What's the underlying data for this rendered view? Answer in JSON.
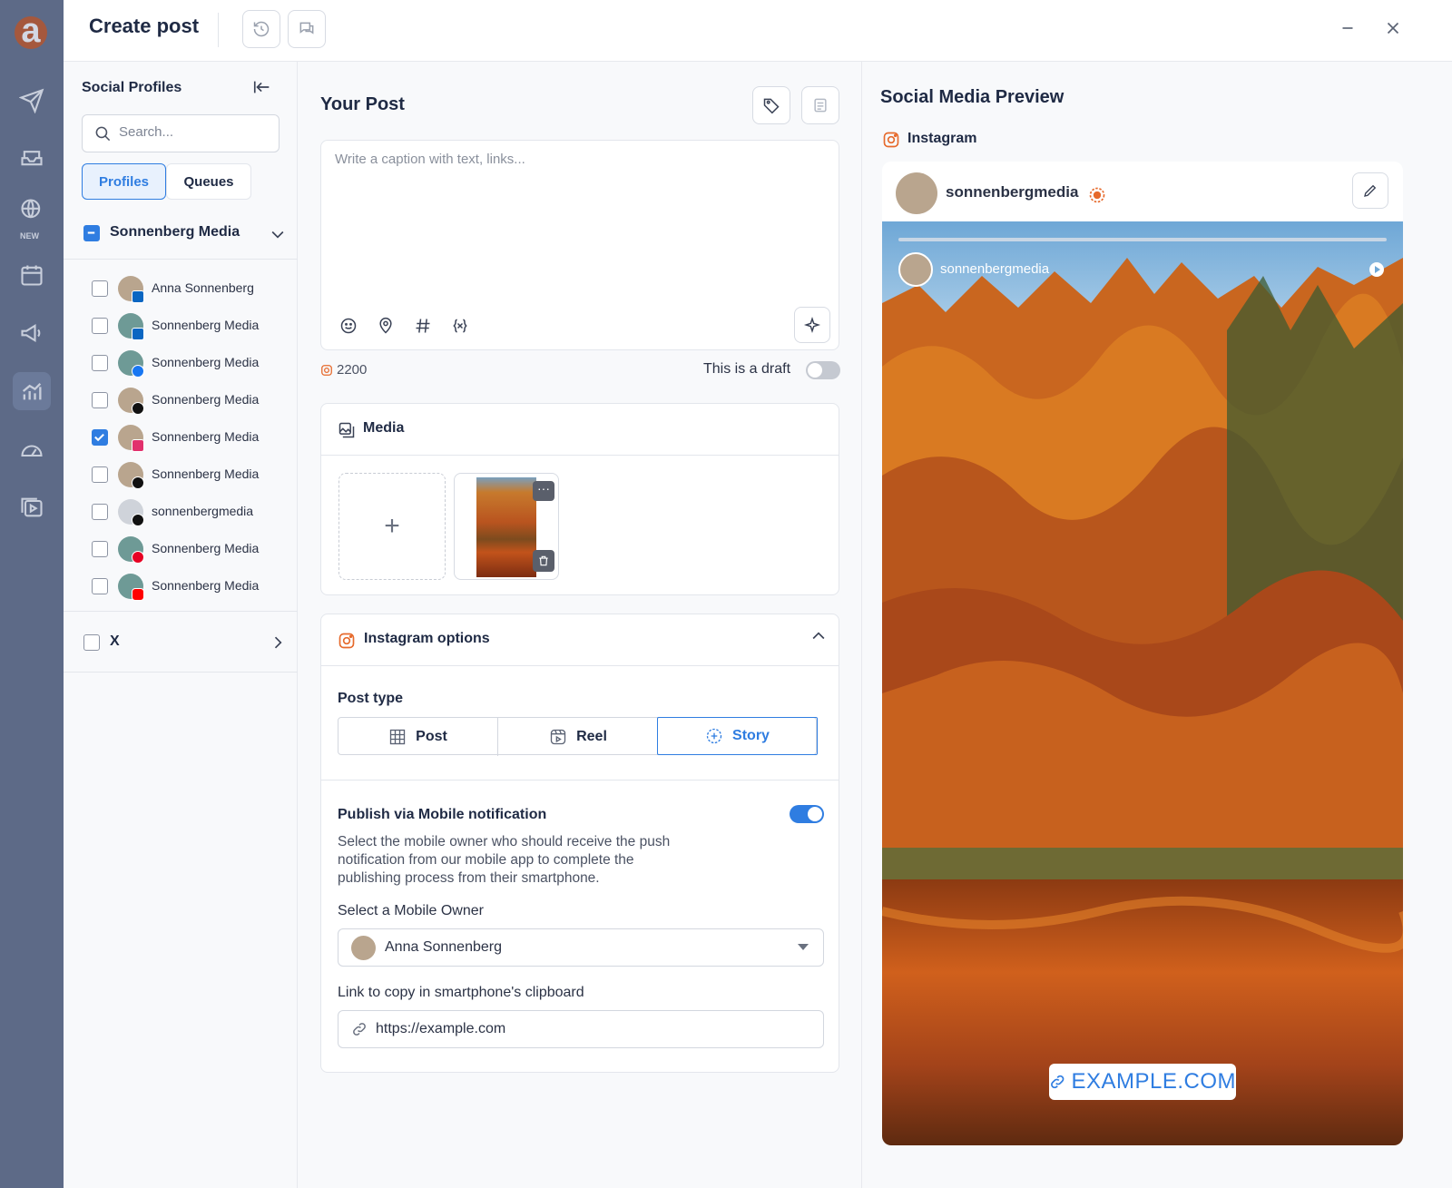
{
  "app": {
    "title": "Create post",
    "logo_letter": "a",
    "rail_new_tag": "NEW"
  },
  "sidebar": {
    "title": "Social Profiles",
    "search_placeholder": "Search...",
    "tabs": [
      {
        "label": "Profiles",
        "active": true
      },
      {
        "label": "Queues",
        "active": false
      }
    ],
    "group": {
      "name": "Sonnenberg Media"
    },
    "profiles": [
      {
        "name": "Anna Sonnenberg",
        "network": "linkedin",
        "checked": false
      },
      {
        "name": "Sonnenberg Media",
        "network": "linkedin",
        "checked": false
      },
      {
        "name": "Sonnenberg Media",
        "network": "facebook",
        "checked": false
      },
      {
        "name": "Sonnenberg Media",
        "network": "x",
        "checked": false
      },
      {
        "name": "Sonnenberg Media",
        "network": "instagram",
        "checked": true
      },
      {
        "name": "Sonnenberg Media",
        "network": "threads",
        "checked": false
      },
      {
        "name": "sonnenbergmedia",
        "network": "tiktok",
        "checked": false
      },
      {
        "name": "Sonnenberg Media",
        "network": "pinterest",
        "checked": false
      },
      {
        "name": "Sonnenberg Media",
        "network": "youtube",
        "checked": false
      }
    ],
    "group2": {
      "name": "X"
    }
  },
  "post": {
    "title": "Your Post",
    "caption_placeholder": "Write a caption with text, links...",
    "char_count": "2200",
    "draft_label": "This is a draft",
    "draft_on": false
  },
  "media": {
    "title": "Media",
    "add_symbol": "+"
  },
  "instagram_options": {
    "title": "Instagram options",
    "post_type_label": "Post type",
    "types": [
      {
        "label": "Post"
      },
      {
        "label": "Reel"
      },
      {
        "label": "Story"
      }
    ],
    "selected_type": "Story",
    "mobile_title": "Publish via Mobile notification",
    "mobile_on": true,
    "mobile_desc": "Select the mobile owner who should receive the push notification from our mobile app to complete the publishing process from their smartphone.",
    "owner_label": "Select a Mobile Owner",
    "owner_value": "Anna Sonnenberg",
    "link_label": "Link to copy in smartphone's clipboard",
    "link_value": "https://example.com"
  },
  "preview": {
    "title": "Social Media Preview",
    "network": "Instagram",
    "username": "sonnenbergmedia",
    "story_username": "sonnenbergmedia",
    "link_sticker": "EXAMPLE.COM"
  },
  "colors": {
    "accent": "#2f7de1",
    "rail": "#5d6a87",
    "instagram": "#e1306c"
  }
}
